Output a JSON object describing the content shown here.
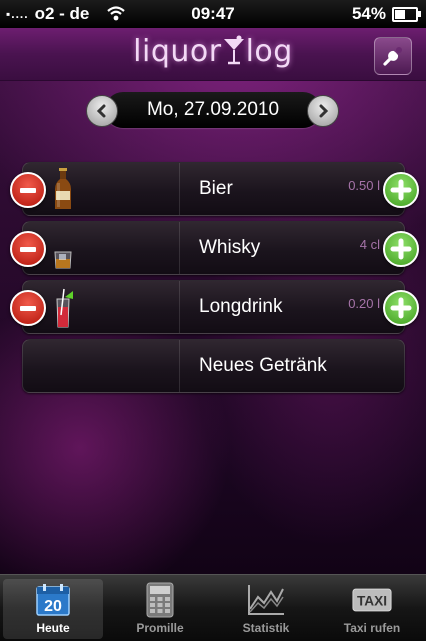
{
  "status_bar": {
    "signal": "▪....",
    "carrier": "o2 - de",
    "time": "09:47",
    "battery_percent": "54%",
    "battery_level": 0.54
  },
  "app": {
    "logo_text_left": "liquor",
    "logo_text_right": "log",
    "date": "Mo, 27.09.2010"
  },
  "drinks": [
    {
      "name": "Bier",
      "amount": "0.50 l",
      "icon": "beer-bottle-icon"
    },
    {
      "name": "Whisky",
      "amount": "4 cl",
      "icon": "whisky-glass-icon"
    },
    {
      "name": "Longdrink",
      "amount": "0.20 l",
      "icon": "longdrink-glass-icon"
    }
  ],
  "new_drink_label": "Neues Getränk",
  "tabs": [
    {
      "label": "Heute",
      "icon": "calendar-icon",
      "calendar_day": "20",
      "active": true
    },
    {
      "label": "Promille",
      "icon": "calculator-icon",
      "active": false
    },
    {
      "label": "Statistik",
      "icon": "chart-icon",
      "active": false
    },
    {
      "label": "Taxi rufen",
      "icon": "taxi-icon",
      "sign_text": "TAXI",
      "active": false
    }
  ],
  "colors": {
    "accent_purple": "#4a1350",
    "amount_text": "#a573a8",
    "minus_red": "#d0261a",
    "plus_green": "#5fbf38"
  }
}
